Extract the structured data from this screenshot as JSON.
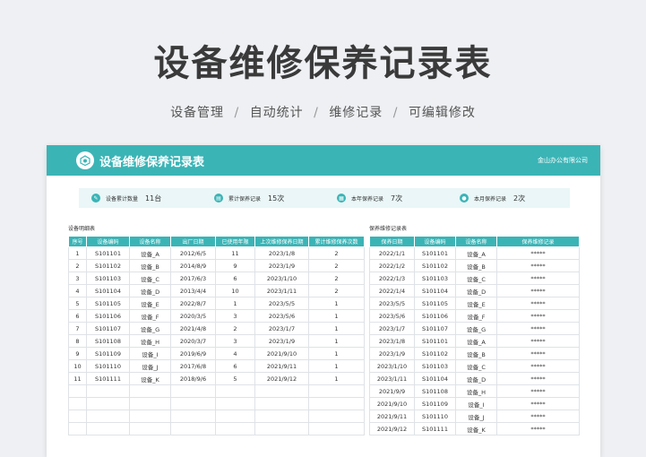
{
  "header": {
    "title": "设备维修保养记录表",
    "tags": [
      "设备管理",
      "自动统计",
      "维修记录",
      "可编辑修改"
    ],
    "separator": "/"
  },
  "sheet": {
    "title": "设备维修保养记录表",
    "company": "金山办公有限公司",
    "accent_color": "#3bb4b6"
  },
  "stats": [
    {
      "icon": "wrench-icon",
      "label": "设备累计数量",
      "value": "11台"
    },
    {
      "icon": "clipboard-icon",
      "label": "累计保养记录",
      "value": "15次"
    },
    {
      "icon": "calendar-icon",
      "label": "本年保养记录",
      "value": "7次"
    },
    {
      "icon": "user-icon",
      "label": "本月保养记录",
      "value": "2次"
    }
  ],
  "left_table": {
    "label": "设备明细表",
    "columns": [
      "序号",
      "设备编码",
      "设备名称",
      "出厂日期",
      "已使用年限",
      "上次维修保养日期",
      "累计维修保养次数"
    ],
    "rows": [
      [
        "1",
        "S101101",
        "设备_A",
        "2012/6/5",
        "11",
        "2023/1/8",
        "2"
      ],
      [
        "2",
        "S101102",
        "设备_B",
        "2014/8/9",
        "9",
        "2023/1/9",
        "2"
      ],
      [
        "3",
        "S101103",
        "设备_C",
        "2017/6/3",
        "6",
        "2023/1/10",
        "2"
      ],
      [
        "4",
        "S101104",
        "设备_D",
        "2013/4/4",
        "10",
        "2023/1/11",
        "2"
      ],
      [
        "5",
        "S101105",
        "设备_E",
        "2022/8/7",
        "1",
        "2023/5/5",
        "1"
      ],
      [
        "6",
        "S101106",
        "设备_F",
        "2020/3/5",
        "3",
        "2023/5/6",
        "1"
      ],
      [
        "7",
        "S101107",
        "设备_G",
        "2021/4/8",
        "2",
        "2023/1/7",
        "1"
      ],
      [
        "8",
        "S101108",
        "设备_H",
        "2020/3/7",
        "3",
        "2023/1/9",
        "1"
      ],
      [
        "9",
        "S101109",
        "设备_I",
        "2019/6/9",
        "4",
        "2021/9/10",
        "1"
      ],
      [
        "10",
        "S101110",
        "设备_J",
        "2017/6/8",
        "6",
        "2021/9/11",
        "1"
      ],
      [
        "11",
        "S101111",
        "设备_K",
        "2018/9/6",
        "5",
        "2021/9/12",
        "1"
      ],
      [
        "",
        "",
        "",
        "",
        "",
        "",
        ""
      ],
      [
        "",
        "",
        "",
        "",
        "",
        "",
        ""
      ],
      [
        "",
        "",
        "",
        "",
        "",
        "",
        ""
      ],
      [
        "",
        "",
        "",
        "",
        "",
        "",
        ""
      ]
    ]
  },
  "right_table": {
    "label": "保养维修记录表",
    "columns": [
      "保养日期",
      "设备编码",
      "设备名称",
      "保养维修记录"
    ],
    "rows": [
      [
        "2022/1/1",
        "S101101",
        "设备_A",
        "*****"
      ],
      [
        "2022/1/2",
        "S101102",
        "设备_B",
        "*****"
      ],
      [
        "2022/1/3",
        "S101103",
        "设备_C",
        "*****"
      ],
      [
        "2022/1/4",
        "S101104",
        "设备_D",
        "*****"
      ],
      [
        "2023/5/5",
        "S101105",
        "设备_E",
        "*****"
      ],
      [
        "2023/5/6",
        "S101106",
        "设备_F",
        "*****"
      ],
      [
        "2023/1/7",
        "S101107",
        "设备_G",
        "*****"
      ],
      [
        "2023/1/8",
        "S101101",
        "设备_A",
        "*****"
      ],
      [
        "2023/1/9",
        "S101102",
        "设备_B",
        "*****"
      ],
      [
        "2023/1/10",
        "S101103",
        "设备_C",
        "*****"
      ],
      [
        "2023/1/11",
        "S101104",
        "设备_D",
        "*****"
      ],
      [
        "2021/9/9",
        "S101108",
        "设备_H",
        "*****"
      ],
      [
        "2021/9/10",
        "S101109",
        "设备_I",
        "*****"
      ],
      [
        "2021/9/11",
        "S101110",
        "设备_J",
        "*****"
      ],
      [
        "2021/9/12",
        "S101111",
        "设备_K",
        "*****"
      ]
    ]
  }
}
